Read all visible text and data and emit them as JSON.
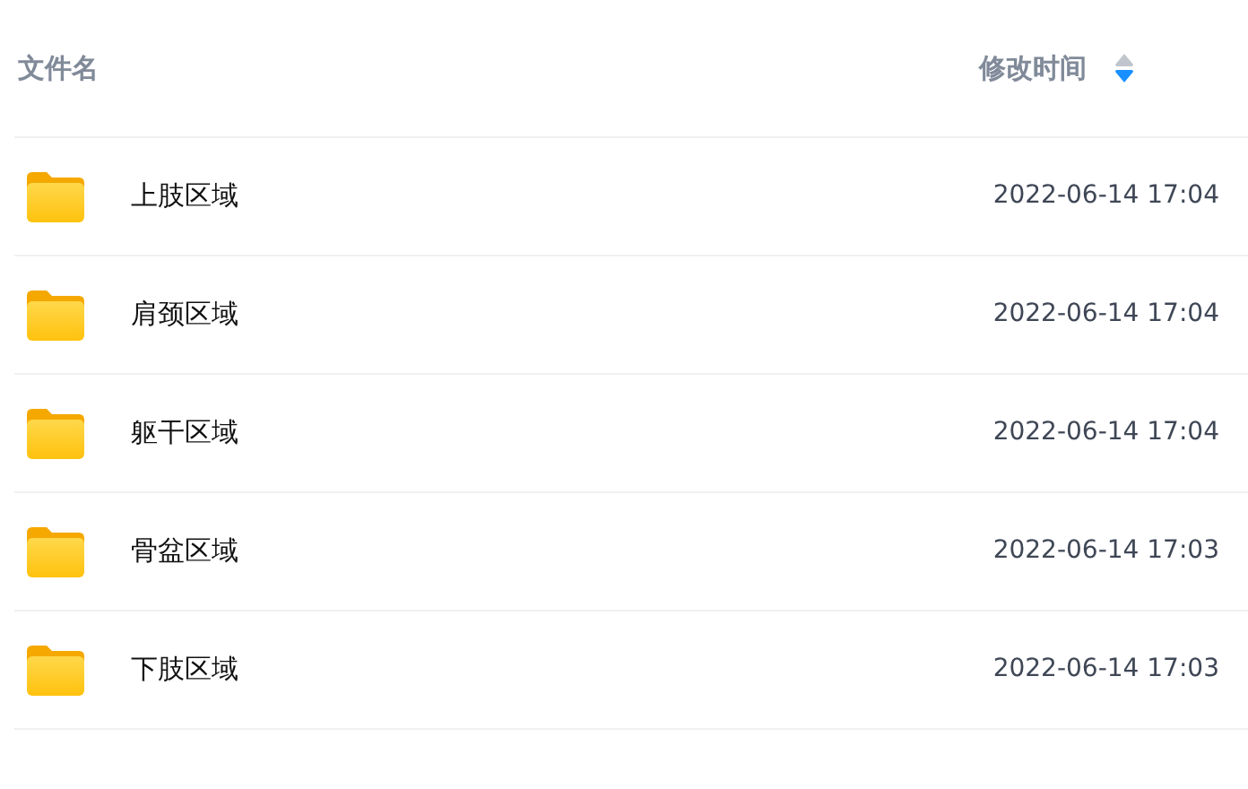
{
  "table": {
    "columns": [
      {
        "label": "文件名"
      },
      {
        "label": "修改时间",
        "sorted_descending": true
      }
    ],
    "rows": [
      {
        "name": "上肢区域",
        "modified": "2022-06-14 17:04"
      },
      {
        "name": "肩颈区域",
        "modified": "2022-06-14 17:04"
      },
      {
        "name": "躯干区域",
        "modified": "2022-06-14 17:04"
      },
      {
        "name": "骨盆区域",
        "modified": "2022-06-14 17:03"
      },
      {
        "name": "下肢区域",
        "modified": "2022-06-14 17:03"
      }
    ]
  }
}
